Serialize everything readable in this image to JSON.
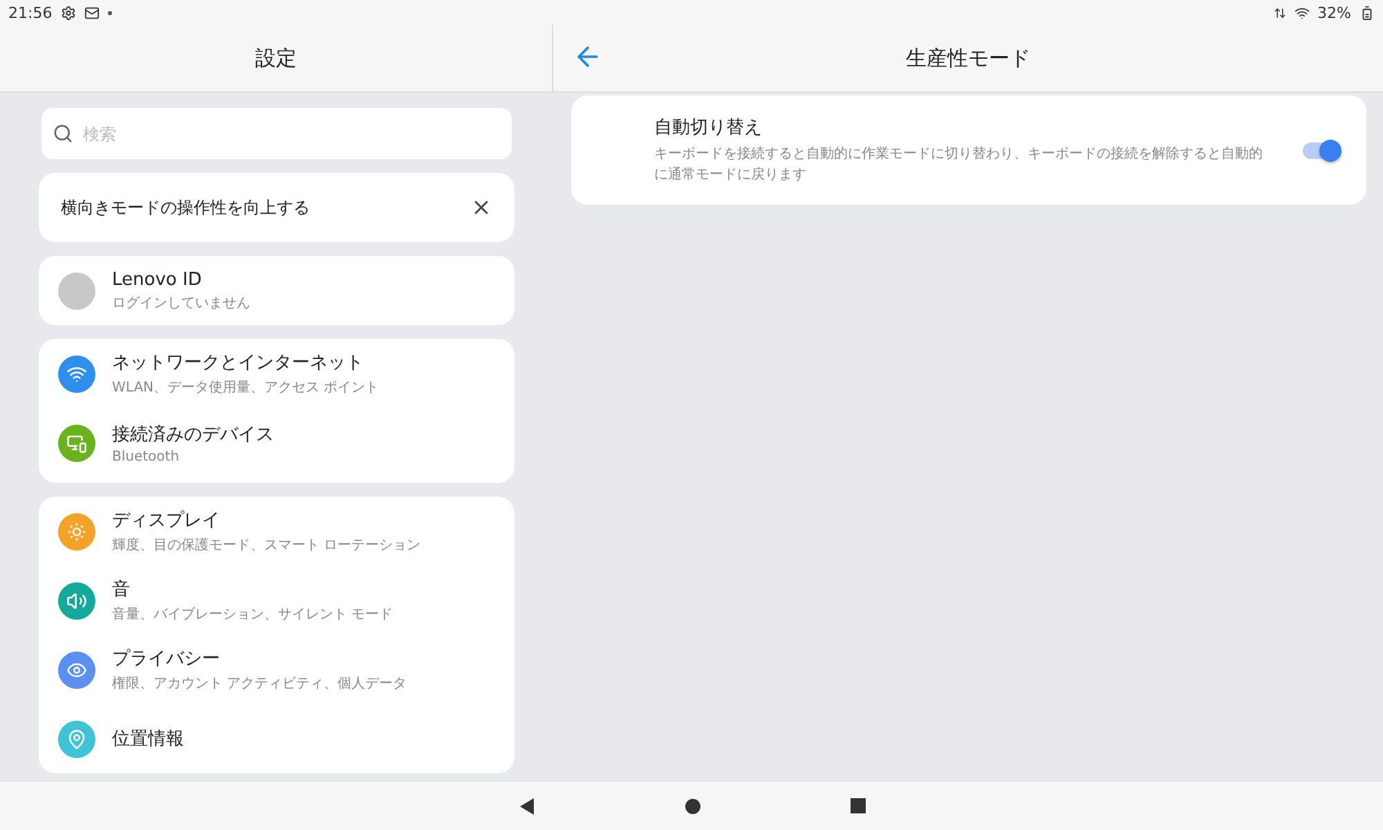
{
  "status_bar": {
    "time": "21:56",
    "battery": "32%"
  },
  "left_panel": {
    "title": "設定",
    "search": {
      "placeholder": "検索"
    },
    "banner": {
      "text": "横向きモードの操作性を向上する"
    },
    "account": {
      "title": "Lenovo ID",
      "subtitle": "ログインしていません"
    },
    "groups": [
      {
        "items": [
          {
            "title": "ネットワークとインターネット",
            "subtitle": "WLAN、データ使用量、アクセス ポイント",
            "color": "#2f8fec"
          },
          {
            "title": "接続済みのデバイス",
            "subtitle": "Bluetooth",
            "color": "#6bb31c"
          }
        ]
      },
      {
        "items": [
          {
            "title": "ディスプレイ",
            "subtitle": "輝度、目の保護モード、スマート ローテーション",
            "color": "#f5a229"
          },
          {
            "title": "音",
            "subtitle": "音量、バイブレーション、サイレント モード",
            "color": "#14a99a"
          },
          {
            "title": "プライバシー",
            "subtitle": "権限、アカウント アクティビティ、個人データ",
            "color": "#5b8ff0"
          },
          {
            "title": "位置情報",
            "color": "#3ec3d8"
          }
        ]
      }
    ]
  },
  "right_panel": {
    "title": "生産性モード",
    "setting": {
      "title": "自動切り替え",
      "description": "キーボードを接続すると自動的に作業モードに切り替わり、キーボードの接続を解除すると自動的に通常モードに戻ります",
      "on": true
    }
  }
}
